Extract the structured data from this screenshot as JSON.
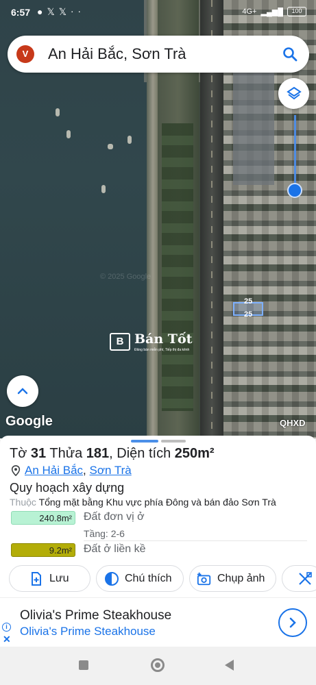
{
  "status_bar": {
    "time": "6:57",
    "left_icons": [
      "whatsapp-icon",
      "x-icon",
      "x-icon",
      "more-dots-icon"
    ],
    "network": "4G+",
    "battery": "100"
  },
  "search": {
    "avatar_letter": "V",
    "query": "An Hải Bắc, Sơn Trà"
  },
  "map": {
    "watermark": "© 2025 Google",
    "parcel_labels": [
      "25",
      "25"
    ],
    "brand": {
      "box_letter": "B",
      "name": "Bán Tốt",
      "tagline": "Đăng bán miễn phí, Tiếp thị đa kênh"
    },
    "google_logo": "Google",
    "overlay_label": "QHXD"
  },
  "sheet": {
    "title_prefix_sheet": "Tờ",
    "sheet_number": "31",
    "title_prefix_lot": "Thửa",
    "lot_number": "181",
    "area_prefix": ", Diện tích",
    "area_value": "250m²",
    "address_ward": "An Hải Bắc",
    "address_sep": ",",
    "address_district": "Sơn Trà",
    "plan_heading": "Quy hoạch xây dựng",
    "belongs_prefix": "Thuộc",
    "belongs_text": "Tổng mặt bằng Khu vực phía Đông và bán đảo Sơn Trà",
    "zones": [
      {
        "area": "240.8m²",
        "label": "Đất đơn vị ở",
        "color": "#b8f2d4",
        "floors": "Tầng: 2-6"
      },
      {
        "area": "9.2m²",
        "label": "Đất ở liền kề",
        "color": "#b3ad08"
      }
    ],
    "actions": [
      {
        "label": "Lưu",
        "icon": "bookmark-add-icon"
      },
      {
        "label": "Chú thích",
        "icon": "legend-icon"
      },
      {
        "label": "Chụp ảnh",
        "icon": "camera-add-icon"
      },
      {
        "label": "",
        "icon": "measure-icon"
      }
    ]
  },
  "ad": {
    "title": "Olivia's Prime Steakhouse",
    "subtitle": "Olivia's Prime Steakhouse",
    "info_glyph": "i",
    "close_glyph": "✕"
  },
  "colors": {
    "accent": "#1a73e8",
    "avatar": "#c7391a"
  }
}
